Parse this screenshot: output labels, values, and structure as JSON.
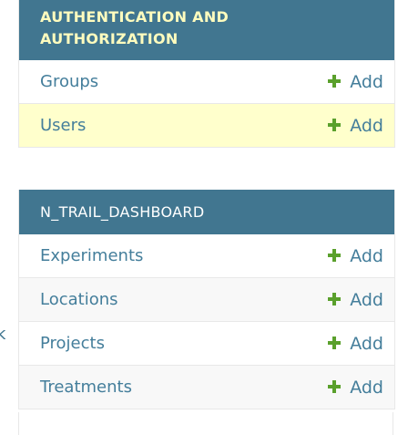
{
  "sidebar_fragment": {
    "text": "k"
  },
  "modules": [
    {
      "title": "AUTHENTICATION AND AUTHORIZATION",
      "title_lines": [
        "AUTHENTICATION AND",
        "AUTHORIZATION"
      ],
      "models": [
        {
          "name": "Groups",
          "add_label": "Add"
        },
        {
          "name": "Users",
          "add_label": "Add",
          "selected": true
        }
      ]
    },
    {
      "title": "N_TRAIL_DASHBOARD",
      "models": [
        {
          "name": "Experiments",
          "add_label": "Add"
        },
        {
          "name": "Locations",
          "add_label": "Add"
        },
        {
          "name": "Projects",
          "add_label": "Add"
        },
        {
          "name": "Treatments",
          "add_label": "Add"
        }
      ]
    }
  ],
  "colors": {
    "header_bg": "#417690",
    "auth_header_text": "#fffcbe",
    "link": "#447e9b",
    "add_icon": "#5aa02c",
    "selected_row": "#ffffcc"
  },
  "icons": {
    "add": "plus-icon"
  }
}
